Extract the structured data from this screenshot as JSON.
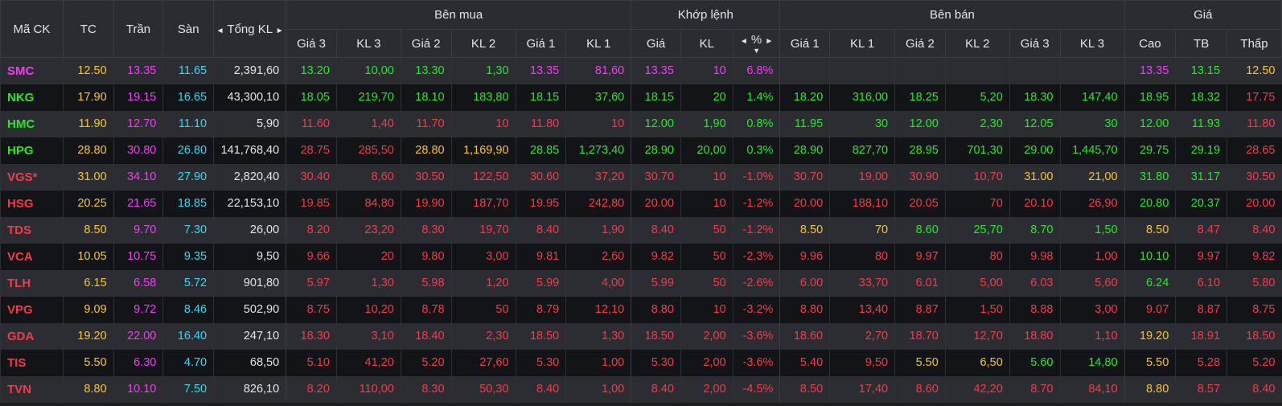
{
  "colors": {
    "ceiling": "#f23cf2",
    "floor": "#38d8ee",
    "up": "#29e62b",
    "down": "#f23b48",
    "ref": "#f4c531",
    "neutral": "#e4e4e4"
  },
  "header": {
    "symbol": "Mã CK",
    "ref": "TC",
    "ceiling": "Trần",
    "floor": "Sàn",
    "total_volume": "Tổng KL",
    "buy_side": "Bên mua",
    "matched": "Khớp lệnh",
    "sell_side": "Bên bán",
    "price": "Giá",
    "price3": "Giá 3",
    "vol3": "KL 3",
    "price2": "Giá 2",
    "vol2": "KL 2",
    "price1": "Giá 1",
    "vol1": "KL 1",
    "match_price": "Giá",
    "match_vol": "KL",
    "percent": "%",
    "high": "Cao",
    "avg": "TB",
    "low": "Thấp",
    "arrow_left": "◄",
    "arrow_right": "►",
    "sort_down": "▼"
  },
  "rows": [
    {
      "sym": "SMC",
      "c": [
        "12.50",
        "13.35",
        "11.65",
        "2,391,60",
        "13.20",
        "10,00",
        "13.30",
        "1,30",
        "13.35",
        "81,60",
        "13.35",
        "10",
        "6.8%",
        "",
        "",
        "",
        "",
        "",
        "",
        "13.35",
        "13.15",
        "12.50"
      ],
      "k": [
        "ce",
        "r",
        "ce",
        "fl",
        "n",
        "u",
        "u",
        "u",
        "u",
        "ce",
        "ce",
        "ce",
        "ce",
        "ce",
        "",
        "",
        "",
        "",
        "",
        "",
        "ce",
        "u",
        "r"
      ]
    },
    {
      "sym": "NKG",
      "c": [
        "17.90",
        "19.15",
        "16.65",
        "43,300,10",
        "18.05",
        "219,70",
        "18.10",
        "183,80",
        "18.15",
        "37,60",
        "18.15",
        "20",
        "1.4%",
        "18.20",
        "316,00",
        "18.25",
        "5,20",
        "18.30",
        "147,40",
        "18.95",
        "18.32",
        "17.75"
      ],
      "k": [
        "u",
        "r",
        "ce",
        "fl",
        "n",
        "u",
        "u",
        "u",
        "u",
        "u",
        "u",
        "u",
        "u",
        "u",
        "u",
        "u",
        "u",
        "u",
        "u",
        "u",
        "u",
        "u",
        "d"
      ]
    },
    {
      "sym": "HMC",
      "c": [
        "11.90",
        "12.70",
        "11.10",
        "5,90",
        "11.60",
        "1,40",
        "11.70",
        "10",
        "11.80",
        "10",
        "12.00",
        "1,90",
        "0.8%",
        "11.95",
        "30",
        "12.00",
        "2,30",
        "12.05",
        "30",
        "12.00",
        "11.93",
        "11.80"
      ],
      "k": [
        "u",
        "r",
        "ce",
        "fl",
        "n",
        "d",
        "d",
        "d",
        "d",
        "d",
        "d",
        "u",
        "u",
        "u",
        "u",
        "u",
        "u",
        "u",
        "u",
        "u",
        "u",
        "u",
        "d"
      ]
    },
    {
      "sym": "HPG",
      "c": [
        "28.80",
        "30.80",
        "26.80",
        "141,768,40",
        "28.75",
        "285,50",
        "28.80",
        "1,169,90",
        "28.85",
        "1,273,40",
        "28.90",
        "20,00",
        "0.3%",
        "28.90",
        "827,70",
        "28.95",
        "701,30",
        "29.00",
        "1,445,70",
        "29.75",
        "29.19",
        "28.65"
      ],
      "k": [
        "u",
        "r",
        "ce",
        "fl",
        "n",
        "d",
        "d",
        "r",
        "r",
        "u",
        "u",
        "u",
        "u",
        "u",
        "u",
        "u",
        "u",
        "u",
        "u",
        "u",
        "u",
        "u",
        "d"
      ]
    },
    {
      "sym": "VGS*",
      "c": [
        "31.00",
        "34.10",
        "27.90",
        "2,820,40",
        "30.40",
        "8,60",
        "30.50",
        "122,50",
        "30.60",
        "37,20",
        "30.70",
        "10",
        "-1.0%",
        "30.70",
        "19,00",
        "30.90",
        "10,70",
        "31.00",
        "21,00",
        "31.80",
        "31.17",
        "30.50"
      ],
      "k": [
        "d",
        "r",
        "ce",
        "fl",
        "n",
        "d",
        "d",
        "d",
        "d",
        "d",
        "d",
        "d",
        "d",
        "d",
        "d",
        "d",
        "d",
        "d",
        "r",
        "r",
        "u",
        "u",
        "d"
      ]
    },
    {
      "sym": "HSG",
      "c": [
        "20.25",
        "21.65",
        "18.85",
        "22,153,10",
        "19.85",
        "84,80",
        "19.90",
        "187,70",
        "19.95",
        "242,80",
        "20.00",
        "10",
        "-1.2%",
        "20.00",
        "188,10",
        "20.05",
        "70",
        "20.10",
        "26,90",
        "20.80",
        "20.37",
        "20.00"
      ],
      "k": [
        "d",
        "r",
        "ce",
        "fl",
        "n",
        "d",
        "d",
        "d",
        "d",
        "d",
        "d",
        "d",
        "d",
        "d",
        "d",
        "d",
        "d",
        "d",
        "d",
        "d",
        "u",
        "u",
        "d"
      ]
    },
    {
      "sym": "TDS",
      "c": [
        "8.50",
        "9.70",
        "7.30",
        "26,00",
        "8.20",
        "23,20",
        "8.30",
        "19,70",
        "8.40",
        "1,90",
        "8.40",
        "50",
        "-1.2%",
        "8.50",
        "70",
        "8.60",
        "25,70",
        "8.70",
        "1,50",
        "8.50",
        "8.47",
        "8.40"
      ],
      "k": [
        "d",
        "r",
        "ce",
        "fl",
        "n",
        "d",
        "d",
        "d",
        "d",
        "d",
        "d",
        "d",
        "d",
        "d",
        "r",
        "r",
        "u",
        "u",
        "u",
        "u",
        "r",
        "d",
        "d"
      ]
    },
    {
      "sym": "VCA",
      "c": [
        "10.05",
        "10.75",
        "9.35",
        "9,50",
        "9.66",
        "20",
        "9.80",
        "3,00",
        "9.81",
        "2,60",
        "9.82",
        "50",
        "-2.3%",
        "9.96",
        "80",
        "9.97",
        "80",
        "9.98",
        "1,00",
        "10.10",
        "9.97",
        "9.82"
      ],
      "k": [
        "d",
        "r",
        "ce",
        "fl",
        "n",
        "d",
        "d",
        "d",
        "d",
        "d",
        "d",
        "d",
        "d",
        "d",
        "d",
        "d",
        "d",
        "d",
        "d",
        "d",
        "u",
        "d",
        "d"
      ]
    },
    {
      "sym": "TLH",
      "c": [
        "6.15",
        "6.58",
        "5.72",
        "901,80",
        "5.97",
        "1,30",
        "5.98",
        "1,20",
        "5.99",
        "4,00",
        "5.99",
        "50",
        "-2.6%",
        "6.00",
        "33,70",
        "6.01",
        "5,00",
        "6.03",
        "5,60",
        "6.24",
        "6.10",
        "5.80"
      ],
      "k": [
        "d",
        "r",
        "ce",
        "fl",
        "n",
        "d",
        "d",
        "d",
        "d",
        "d",
        "d",
        "d",
        "d",
        "d",
        "d",
        "d",
        "d",
        "d",
        "d",
        "d",
        "u",
        "d",
        "d"
      ]
    },
    {
      "sym": "VPG",
      "c": [
        "9.09",
        "9.72",
        "8.46",
        "502,90",
        "8.75",
        "10,20",
        "8.78",
        "50",
        "8.79",
        "12,10",
        "8.80",
        "10",
        "-3.2%",
        "8.80",
        "13,40",
        "8.87",
        "1,50",
        "8.88",
        "3,00",
        "9.07",
        "8.87",
        "8.75"
      ],
      "k": [
        "d",
        "r",
        "ce",
        "fl",
        "n",
        "d",
        "d",
        "d",
        "d",
        "d",
        "d",
        "d",
        "d",
        "d",
        "d",
        "d",
        "d",
        "d",
        "d",
        "d",
        "d",
        "d",
        "d"
      ]
    },
    {
      "sym": "GDA",
      "c": [
        "19.20",
        "22.00",
        "16.40",
        "247,10",
        "18.30",
        "3,10",
        "18.40",
        "2,30",
        "18.50",
        "1,30",
        "18.50",
        "2,00",
        "-3.6%",
        "18.60",
        "2,70",
        "18.70",
        "12,70",
        "18.80",
        "1,10",
        "19.20",
        "18.91",
        "18.50"
      ],
      "k": [
        "d",
        "r",
        "ce",
        "fl",
        "n",
        "d",
        "d",
        "d",
        "d",
        "d",
        "d",
        "d",
        "d",
        "d",
        "d",
        "d",
        "d",
        "d",
        "d",
        "d",
        "r",
        "d",
        "d"
      ]
    },
    {
      "sym": "TIS",
      "c": [
        "5.50",
        "6.30",
        "4.70",
        "68,50",
        "5.10",
        "41,20",
        "5.20",
        "27,60",
        "5.30",
        "1,00",
        "5.30",
        "2,00",
        "-3.6%",
        "5.40",
        "9,50",
        "5.50",
        "6,50",
        "5.60",
        "14,80",
        "5.50",
        "5.28",
        "5.20"
      ],
      "k": [
        "d",
        "r",
        "ce",
        "fl",
        "n",
        "d",
        "d",
        "d",
        "d",
        "d",
        "d",
        "d",
        "d",
        "d",
        "d",
        "d",
        "r",
        "r",
        "u",
        "u",
        "r",
        "d",
        "d"
      ]
    },
    {
      "sym": "TVN",
      "c": [
        "8.80",
        "10.10",
        "7.50",
        "826,10",
        "8.20",
        "110,00",
        "8.30",
        "50,30",
        "8.40",
        "1,00",
        "8.40",
        "2,00",
        "-4.5%",
        "8.50",
        "17,40",
        "8.60",
        "42,20",
        "8.70",
        "84,10",
        "8.80",
        "8.57",
        "8.40"
      ],
      "k": [
        "d",
        "r",
        "ce",
        "fl",
        "n",
        "d",
        "d",
        "d",
        "d",
        "d",
        "d",
        "d",
        "d",
        "d",
        "d",
        "d",
        "d",
        "d",
        "d",
        "d",
        "r",
        "d",
        "d"
      ]
    }
  ]
}
